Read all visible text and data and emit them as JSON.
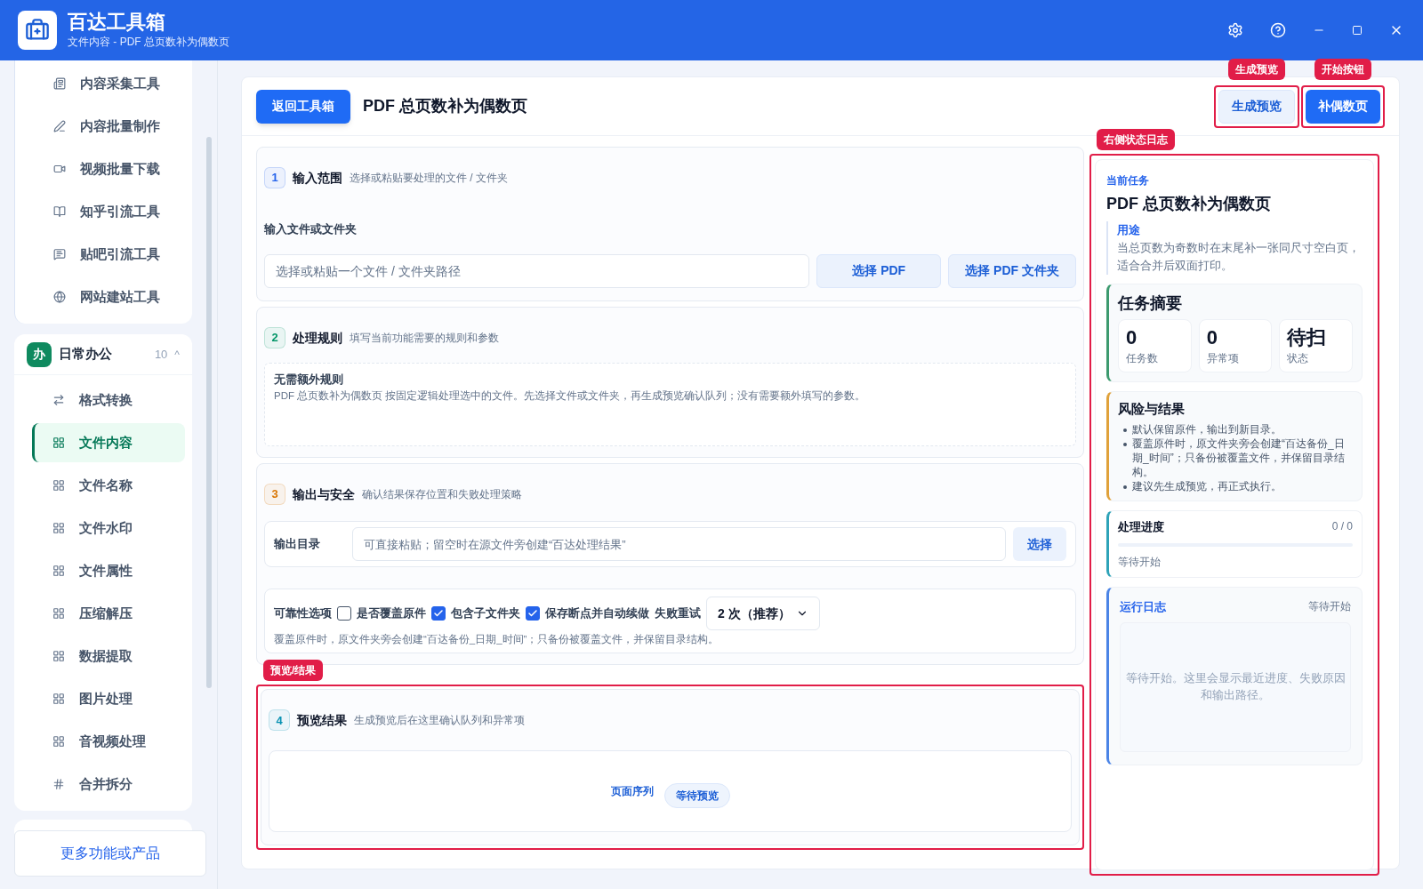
{
  "app": {
    "title": "百达工具箱",
    "subtitle": "文件内容 - PDF 总页数补为偶数页"
  },
  "sidebar": {
    "groups": [
      {
        "items": [
          {
            "label": "内容采集工具",
            "selected": false
          },
          {
            "label": "内容批量制作",
            "selected": false
          },
          {
            "label": "视频批量下载",
            "selected": false
          },
          {
            "label": "知乎引流工具",
            "selected": false
          },
          {
            "label": "贴吧引流工具",
            "selected": false
          },
          {
            "label": "网站建站工具",
            "selected": false
          }
        ]
      },
      {
        "badge": "办",
        "label": "日常办公",
        "count": "10",
        "caret": "^",
        "expanded": true,
        "items": [
          {
            "label": "格式转换",
            "selected": false
          },
          {
            "label": "文件内容",
            "selected": true
          },
          {
            "label": "文件名称",
            "selected": false
          },
          {
            "label": "文件水印",
            "selected": false
          },
          {
            "label": "文件属性",
            "selected": false
          },
          {
            "label": "压缩解压",
            "selected": false
          },
          {
            "label": "数据提取",
            "selected": false
          },
          {
            "label": "图片处理",
            "selected": false
          },
          {
            "label": "音视频处理",
            "selected": false
          },
          {
            "label": "合并拆分",
            "selected": false
          }
        ]
      }
    ],
    "more_button": "更多功能或产品"
  },
  "toolbar": {
    "back_button": "返回工具箱",
    "title": "PDF 总页数补为偶数页",
    "buttons": [
      {
        "label": "生成预览",
        "kind": "secondary",
        "annotation": "生成预览"
      },
      {
        "label": "补偶数页",
        "kind": "primary",
        "annotation": "开始按钮"
      }
    ]
  },
  "sections": [
    {
      "kind": "input",
      "number": "1",
      "color": "#2563eb",
      "title": "输入范围",
      "hint": "选择或粘贴要处理的文件 / 文件夹",
      "field_label": "输入文件或文件夹",
      "placeholder": "选择或粘贴一个文件 / 文件夹路径",
      "buttons": [
        "选择 PDF",
        "选择 PDF 文件夹"
      ]
    },
    {
      "kind": "rules",
      "number": "2",
      "color": "#059669",
      "title": "处理规则",
      "hint": "填写当前功能需要的规则和参数",
      "rule_title": "无需额外规则",
      "rule_text": "PDF 总页数补为偶数页 按固定逻辑处理选中的文件。先选择文件或文件夹，再生成预览确认队列；没有需要额外填写的参数。"
    },
    {
      "kind": "output",
      "number": "3",
      "color": "#d97706",
      "title": "输出与安全",
      "hint": "确认结果保存位置和失败处理策略",
      "output_label": "输出目录",
      "placeholder": "可直接粘贴；留空时在源文件旁创建“百达处理结果”",
      "output_button": "选择",
      "options_label": "可靠性选项",
      "options": [
        {
          "label": "是否覆盖原件",
          "checked": false
        },
        {
          "label": "包含子文件夹",
          "checked": true
        },
        {
          "label": "保存断点并自动续做",
          "checked": true
        }
      ],
      "retry_label": "失败重试",
      "retry_value": "2 次（推荐）",
      "note": "覆盖原件时，原文件夹旁会创建“百达备份_日期_时间”；只备份被覆盖文件，并保留目录结构。"
    },
    {
      "kind": "preview",
      "number": "4",
      "color": "#0891b2",
      "title": "预览结果",
      "hint": "生成预览后在这里确认队列和异常项",
      "annotation": "预览/结果",
      "preview_label": "页面序列",
      "preview_status": "等待预览"
    }
  ],
  "side_panel": {
    "annotation": "右侧状态日志",
    "task_label": "当前任务",
    "task_title": "PDF 总页数补为偶数页",
    "purpose_label": "用途",
    "purpose_text": "当总页数为奇数时在末尾补一张同尺寸空白页，适合合并后双面打印。",
    "summary": {
      "title": "任务摘要",
      "stats": [
        {
          "value": "0",
          "label": "任务数"
        },
        {
          "value": "0",
          "label": "异常项"
        },
        {
          "value": "待扫",
          "label": "状态"
        }
      ]
    },
    "risks": {
      "title": "风险与结果",
      "items": [
        "默认保留原件，输出到新目录。",
        "覆盖原件时，原文件夹旁会创建“百达备份_日期_时间”；只备份被覆盖文件，并保留目录结构。",
        "建议先生成预览，再正式执行。"
      ]
    },
    "progress": {
      "title": "处理进度",
      "count": "0 / 0",
      "status": "等待开始"
    },
    "log": {
      "title": "运行日志",
      "status": "等待开始",
      "empty_text": "等待开始。这里会显示最近进度、失败原因和输出路径。"
    }
  }
}
